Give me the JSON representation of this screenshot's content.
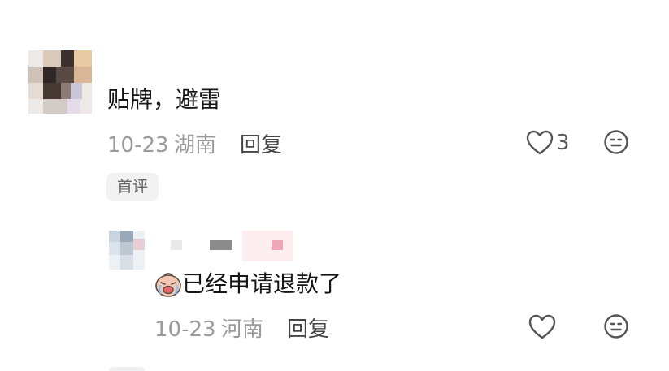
{
  "comment": {
    "text": "贴牌，避雷",
    "date": "10-23",
    "location": "湖南",
    "reply_label": "回复",
    "like_count": "3",
    "badge": "首评"
  },
  "reply": {
    "emoji": "crying-face-emoji",
    "text": "已经申请退款了",
    "date": "10-23",
    "location": "河南",
    "reply_label": "回复"
  },
  "icons": {
    "like": "heart-outline-icon",
    "dislike": "meh-face-icon"
  },
  "colors": {
    "text_primary": "#161616",
    "text_meta": "#9a9a9a",
    "badge_bg": "#f2f2f2"
  }
}
